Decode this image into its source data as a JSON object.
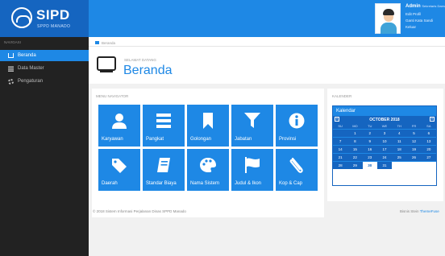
{
  "app": {
    "title": "SIPD",
    "subtitle": "SPPD MANADO"
  },
  "user": {
    "name": "Admin",
    "role": "Sekretaris Daerah",
    "links": [
      "Edit Profil",
      "Ganti Kata Sandi",
      "Keluar"
    ]
  },
  "sidebar": {
    "header": "NAVIGASI",
    "items": [
      {
        "label": "Beranda",
        "active": true,
        "icon": "home-icon"
      },
      {
        "label": "Data Master",
        "active": false,
        "icon": "list-icon"
      },
      {
        "label": "Pengaturan",
        "active": false,
        "icon": "gear-icon"
      }
    ]
  },
  "breadcrumb": {
    "label": "Beranda"
  },
  "hero": {
    "subtitle": "SELAMAT DATANG",
    "title": "Beranda"
  },
  "menu": {
    "title": "MENU NAVIGATOR",
    "tiles": [
      {
        "label": "Karyawan",
        "icon": "user-icon"
      },
      {
        "label": "Pangkat",
        "icon": "stack-icon"
      },
      {
        "label": "Golongan",
        "icon": "bookmark-icon"
      },
      {
        "label": "Jabatan",
        "icon": "filter-icon"
      },
      {
        "label": "Provinsi",
        "icon": "info-icon"
      },
      {
        "label": "Daerah",
        "icon": "tag-icon"
      },
      {
        "label": "Standar Biaya",
        "icon": "book-icon"
      },
      {
        "label": "Nama Sistem",
        "icon": "palette-icon"
      },
      {
        "label": "Judul & Ikon",
        "icon": "flag-icon"
      },
      {
        "label": "Kop & Cap",
        "icon": "paperclip-icon"
      }
    ]
  },
  "footer": {
    "left": "© 2018  Sistem Informasi Perjalanan Dinas  SPPD Manado",
    "right_prefix": "Bisnis Stein ",
    "right_link": "ThemeFuse"
  },
  "calendar": {
    "panel_title": "KALENDER",
    "header": "Kalendar",
    "month": "OCTOBER 2018",
    "prev": "«",
    "next": "»",
    "dow": [
      "SU",
      "MO",
      "TU",
      "WE",
      "TH",
      "FR",
      "SA"
    ],
    "days": [
      "",
      "1",
      "2",
      "3",
      "4",
      "5",
      "6",
      "7",
      "8",
      "9",
      "10",
      "11",
      "12",
      "13",
      "14",
      "15",
      "16",
      "17",
      "18",
      "19",
      "20",
      "21",
      "22",
      "23",
      "24",
      "25",
      "26",
      "27",
      "28",
      "29",
      "30",
      "31",
      "",
      "",
      ""
    ],
    "today": "30"
  },
  "colors": {
    "primary": "#1e88e5",
    "primary_dark": "#1565c0",
    "sidebar": "#222222"
  }
}
